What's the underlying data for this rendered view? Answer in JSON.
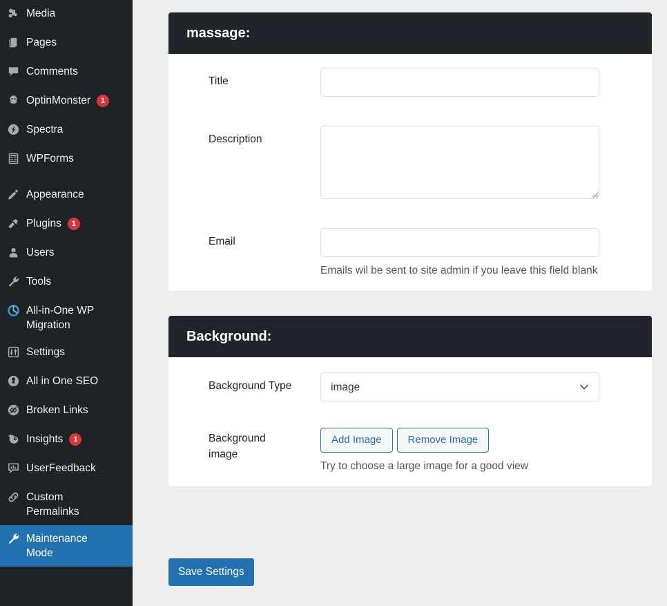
{
  "sidebar": {
    "items": [
      {
        "label": "Media",
        "icon": "media-icon",
        "badge": null,
        "active": false,
        "separator": false
      },
      {
        "label": "Pages",
        "icon": "pages-icon",
        "badge": null,
        "active": false,
        "separator": false
      },
      {
        "label": "Comments",
        "icon": "comments-icon",
        "badge": null,
        "active": false,
        "separator": false
      },
      {
        "label": "OptinMonster",
        "icon": "optinmonster-icon",
        "badge": "1",
        "active": false,
        "separator": false
      },
      {
        "label": "Spectra",
        "icon": "spectra-icon",
        "badge": null,
        "active": false,
        "separator": false
      },
      {
        "label": "WPForms",
        "icon": "wpforms-icon",
        "badge": null,
        "active": false,
        "separator": false
      },
      {
        "label": "Appearance",
        "icon": "appearance-icon",
        "badge": null,
        "active": false,
        "separator": true
      },
      {
        "label": "Plugins",
        "icon": "plugins-icon",
        "badge": "1",
        "active": false,
        "separator": false
      },
      {
        "label": "Users",
        "icon": "users-icon",
        "badge": null,
        "active": false,
        "separator": false
      },
      {
        "label": "Tools",
        "icon": "tools-icon",
        "badge": null,
        "active": false,
        "separator": false
      },
      {
        "label": "All-in-One WP\nMigration",
        "icon": "all-in-one-wp-migration-icon",
        "badge": null,
        "active": false,
        "separator": false
      },
      {
        "label": "Settings",
        "icon": "settings-icon",
        "badge": null,
        "active": false,
        "separator": false
      },
      {
        "label": "All in One SEO",
        "icon": "all-in-one-seo-icon",
        "badge": null,
        "active": false,
        "separator": false
      },
      {
        "label": "Broken Links",
        "icon": "broken-links-icon",
        "badge": null,
        "active": false,
        "separator": false
      },
      {
        "label": "Insights",
        "icon": "insights-icon",
        "badge": "1",
        "active": false,
        "separator": false
      },
      {
        "label": "UserFeedback",
        "icon": "userfeedback-icon",
        "badge": null,
        "active": false,
        "separator": false
      },
      {
        "label": "Custom\nPermalinks",
        "icon": "custom-permalinks-icon",
        "badge": null,
        "active": false,
        "separator": false
      },
      {
        "label": "Maintenance\nMode",
        "icon": "maintenance-mode-icon",
        "badge": null,
        "active": true,
        "separator": false
      }
    ]
  },
  "message_panel": {
    "title": "massage:",
    "title_label": "Title",
    "title_value": "",
    "title_placeholder": "",
    "description_label": "Description",
    "description_value": "",
    "description_placeholder": "",
    "email_label": "Email",
    "email_value": "",
    "email_placeholder": "",
    "email_help": "Emails wil be sent to site admin if you leave this field blank"
  },
  "background_panel": {
    "title": "Background:",
    "type_label": "Background Type",
    "type_value": "image",
    "type_options": [
      "image"
    ],
    "image_label": "Background\nimage",
    "add_image_label": "Add Image",
    "remove_image_label": "Remove Image",
    "image_help": "Try to choose a large image for a good view"
  },
  "footer": {
    "save_label": "Save Settings"
  },
  "colors": {
    "sidebar_bg": "#1d2327",
    "accent": "#2271b1",
    "badge": "#d63638",
    "panel_header": "#21252b",
    "page_bg": "#eeeeee"
  }
}
